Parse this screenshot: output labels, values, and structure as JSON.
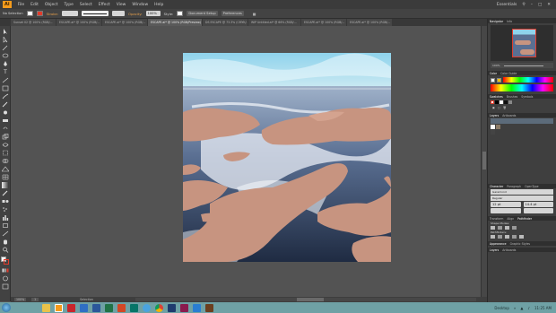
{
  "app": {
    "logo": "Ai",
    "menu": [
      "File",
      "Edit",
      "Object",
      "Type",
      "Select",
      "Effect",
      "View",
      "Window",
      "Help"
    ],
    "workspace": "Essentials"
  },
  "control_bar": {
    "selection_label": "No Selection",
    "stroke_label": "Stroke:",
    "opacity_label": "Opacity:",
    "opacity_value": "100%",
    "style_label": "Style:",
    "doc_setup_button": "Document Setup",
    "preferences_button": "Preferences"
  },
  "doc_tabs": [
    "Sunset 02 @ 100% (RGB/...",
    "ESCAPE.ai* @ 100% (RGB/...",
    "ESCAPE.ai* @ 100% (RGB/...",
    "ESCAPE.ai* @ 100% (RGB/Preview)",
    "DS ESCAPE @ 73.3% (CMYK/...",
    "WIP Untitled.ai* @ 66% (RGB/...",
    "ESCAPE.ai* @ 100% (RGB/...",
    "ESCAPE.ai* @ 100% (RGB/..."
  ],
  "status_bar": {
    "zoom": "100%",
    "page": "1",
    "tool": "Selection"
  },
  "panels": {
    "navigator_tabs": [
      "Navigator",
      "Info"
    ],
    "navigator_zoom": "100%",
    "color_tabs": [
      "Color",
      "Color Guide"
    ],
    "swatches_tabs": [
      "Swatches",
      "Brushes",
      "Symbols"
    ],
    "layers_tabs": [
      "Layers",
      "Artboards"
    ],
    "character_tabs": [
      "Character",
      "Paragraph",
      "OpenType"
    ],
    "font_family": "Garamond",
    "font_style": "Regular",
    "font_size": "12 pt",
    "leading": "14.4 pt",
    "transform_tabs": [
      "Transform",
      "Align",
      "Pathfinder"
    ],
    "shape_modes_label": "Shape Modes:",
    "pathfinders_label": "Pathfinders:",
    "appearance_tabs": [
      "Appearance",
      "Graphic Styles"
    ],
    "extra_tabs": [
      "Layers",
      "Artboards"
    ]
  },
  "taskbar": {
    "location": "Desktop",
    "time": "11:25 AM"
  }
}
